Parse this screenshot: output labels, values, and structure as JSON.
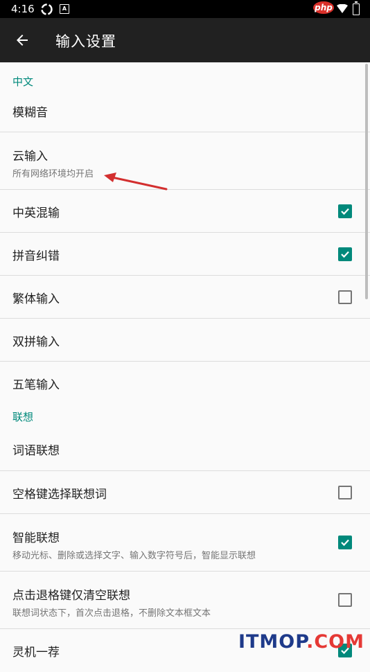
{
  "status_bar": {
    "time": "4:16",
    "icons": [
      "sync-icon",
      "a-badge-icon",
      "php-logo",
      "wifi-icon",
      "battery-icon"
    ],
    "logo_text": "php"
  },
  "app_bar": {
    "back_icon": "arrow-left-icon",
    "title": "输入设置"
  },
  "sections": {
    "chinese": {
      "label": "中文"
    },
    "assoc": {
      "label": "联想"
    }
  },
  "items": {
    "fuzzy": {
      "title": "模糊音"
    },
    "cloud": {
      "title": "云输入",
      "summary": "所有网络环境均开启"
    },
    "mixed": {
      "title": "中英混输",
      "checked": true
    },
    "correct": {
      "title": "拼音纠错",
      "checked": true
    },
    "trad": {
      "title": "繁体输入",
      "checked": false
    },
    "dual": {
      "title": "双拼输入"
    },
    "wubi": {
      "title": "五笔输入"
    },
    "word_assoc": {
      "title": "词语联想"
    },
    "space_assoc": {
      "title": "空格键选择联想词",
      "checked": false
    },
    "smart_assoc": {
      "title": "智能联想",
      "summary": "移动光标、删除或选择文字、输入数字符号后，智能显示联想",
      "checked": true
    },
    "backspace_clear": {
      "title": "点击退格键仅清空联想",
      "summary": "联想词状态下，首次点击退格，不删除文本框文本",
      "checked": false
    },
    "lingji": {
      "title": "灵机一荐",
      "checked": true
    }
  },
  "colors": {
    "accent": "#00897b",
    "app_bar": "#212121",
    "annotation_arrow": "#d32f2f"
  },
  "watermark": {
    "text_a": "ITMOP",
    "text_b": ".COM"
  }
}
